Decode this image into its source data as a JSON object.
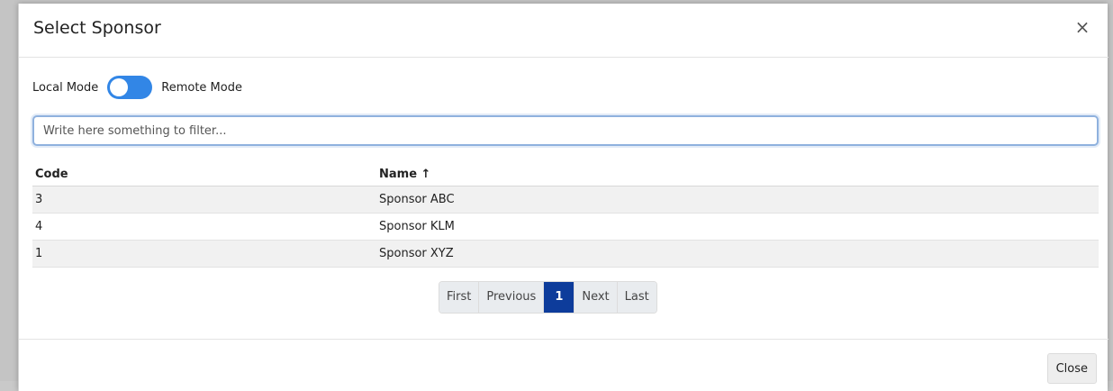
{
  "dialog": {
    "title": "Select Sponsor",
    "close_icon": "×"
  },
  "mode": {
    "local_label": "Local Mode",
    "remote_label": "Remote Mode",
    "toggle_state": "local"
  },
  "filter": {
    "placeholder": "Write here something to filter...",
    "value": ""
  },
  "table": {
    "columns": [
      {
        "label": "Code"
      },
      {
        "label": "Name ↑"
      }
    ],
    "rows": [
      {
        "code": "3",
        "name": "Sponsor ABC"
      },
      {
        "code": "4",
        "name": "Sponsor KLM"
      },
      {
        "code": "1",
        "name": "Sponsor XYZ"
      }
    ]
  },
  "pagination": {
    "first": "First",
    "previous": "Previous",
    "current": "1",
    "next": "Next",
    "last": "Last"
  },
  "footer": {
    "close_label": "Close"
  },
  "colors": {
    "toggle": "#3286e6",
    "active_page": "#0d3c9b"
  }
}
